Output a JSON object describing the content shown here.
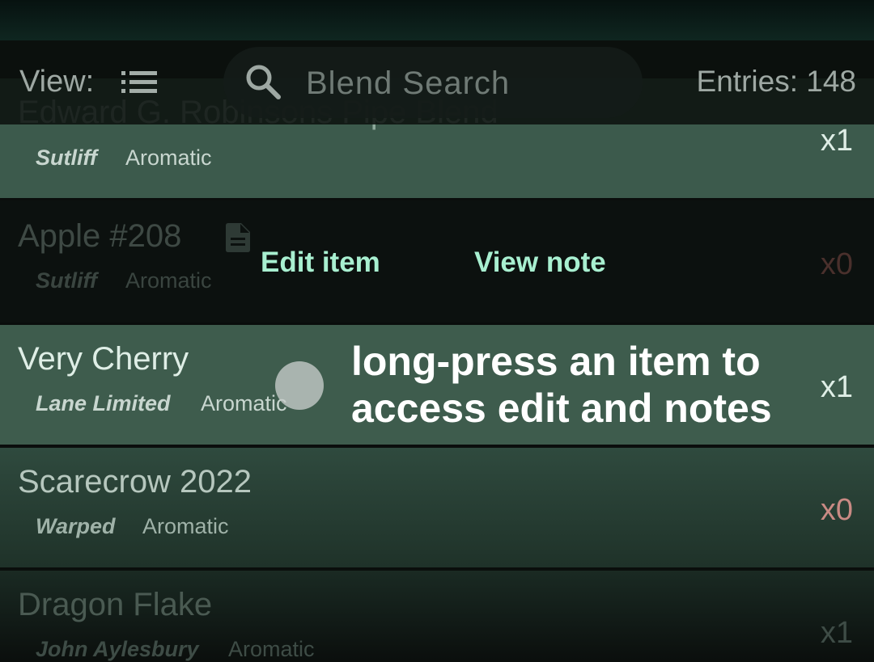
{
  "header": {
    "view_label": "View:",
    "view_icon": "list-icon",
    "search_placeholder": "Blend Search",
    "search_icon": "search-icon",
    "entries": "Entries: 148"
  },
  "items": [
    {
      "name": "Edward G. Robinsons Pipe Blend",
      "brand": "Sutliff",
      "type": "Aromatic",
      "qty": "x1"
    },
    {
      "name": "Apple #208",
      "brand": "Sutliff",
      "type": "Aromatic",
      "qty": "x0",
      "has_note": true,
      "note_icon": "document-icon"
    },
    {
      "name": "Very Cherry",
      "brand": "Lane Limited",
      "type": "Aromatic",
      "qty": "x1"
    },
    {
      "name": "Scarecrow 2022",
      "brand": "Warped",
      "type": "Aromatic",
      "qty": "x0"
    },
    {
      "name": "Dragon Flake",
      "brand": "John Aylesbury",
      "type": "Aromatic",
      "qty": "x1"
    }
  ],
  "context_actions": {
    "edit": "Edit item",
    "view_note": "View note"
  },
  "tutorial": {
    "hint": "long-press an item to access edit and notes"
  },
  "colors": {
    "accent": "#a8efd0",
    "row_selected": "#3e5c4d",
    "qty_zero": "#c98a84"
  }
}
